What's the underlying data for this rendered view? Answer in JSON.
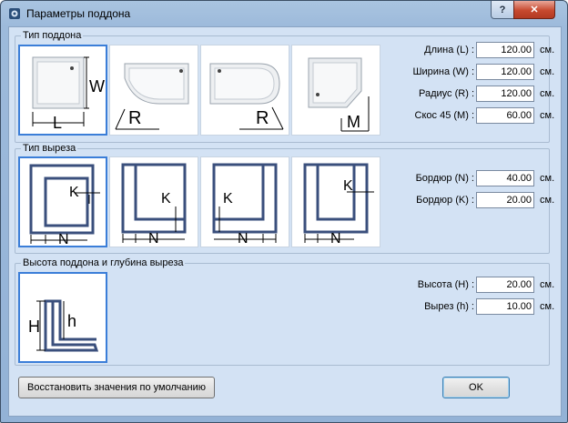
{
  "window": {
    "title": "Параметры поддона",
    "help_label": "?",
    "close_label": "✕"
  },
  "tray_type": {
    "label": "Тип поддона",
    "tiles": [
      {
        "name": "square",
        "labels": [
          "L",
          "W"
        ]
      },
      {
        "name": "quarter-round",
        "labels": [
          "R"
        ]
      },
      {
        "name": "half-round",
        "labels": [
          "R"
        ]
      },
      {
        "name": "pentagon",
        "labels": [
          "M"
        ]
      }
    ],
    "fields": [
      {
        "label": "Длина (L) :",
        "value": "120.00",
        "unit": "см."
      },
      {
        "label": "Ширина (W) :",
        "value": "120.00",
        "unit": "см."
      },
      {
        "label": "Радиус (R) :",
        "value": "120.00",
        "unit": "см."
      },
      {
        "label": "Скос 45 (M) :",
        "value": "60.00",
        "unit": "см."
      }
    ]
  },
  "cut_type": {
    "label": "Тип выреза",
    "tiles": [
      {
        "labels": [
          "K",
          "N"
        ]
      },
      {
        "labels": [
          "K",
          "N"
        ]
      },
      {
        "labels": [
          "K",
          "N"
        ]
      },
      {
        "labels": [
          "K",
          "N"
        ]
      }
    ],
    "fields": [
      {
        "label": "Бордюр (N) :",
        "value": "40.00",
        "unit": "см."
      },
      {
        "label": "Бордюр (K) :",
        "value": "20.00",
        "unit": "см."
      }
    ]
  },
  "height": {
    "label": "Высота поддона и глубина выреза",
    "tile_labels": [
      "H",
      "h"
    ],
    "fields": [
      {
        "label": "Высота (H) :",
        "value": "20.00",
        "unit": "см."
      },
      {
        "label": "Вырез (h) :",
        "value": "10.00",
        "unit": "см."
      }
    ]
  },
  "buttons": {
    "restore": "Восстановить значения по умолчанию",
    "ok": "OK"
  }
}
